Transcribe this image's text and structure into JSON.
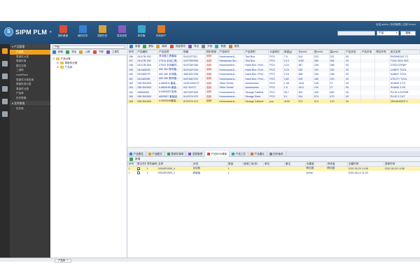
{
  "header": {
    "logo": "SIPM PLM",
    "logo_caret": "▾",
    "user_info": "欢迎,admin | 系统管理 | 注销 Server",
    "search_select": "产品",
    "search_button": "搜索",
    "tools": [
      {
        "label": "我的桌面",
        "color": "#e24a3a",
        "icon": "desktop-icon"
      },
      {
        "label": "我的任务",
        "color": "#3a7fd0",
        "icon": "task-icon"
      },
      {
        "label": "流程任务",
        "color": "#d9a23a",
        "icon": "flow-icon"
      },
      {
        "label": "发送消息",
        "color": "#8a5ac0",
        "icon": "message-icon"
      },
      {
        "label": "收件箱",
        "color": "#3aa6c8",
        "icon": "inbox-icon"
      },
      {
        "label": "在线用户",
        "color": "#e07a2a",
        "icon": "online-user-icon"
      }
    ]
  },
  "rail": [
    {
      "icon": "product-icon",
      "color": "#f0a020"
    },
    {
      "icon": "home-icon",
      "color": "#9aa4ae"
    },
    {
      "icon": "calendar-icon",
      "color": "#9aa4ae"
    },
    {
      "icon": "document-icon",
      "color": "#9aa4ae"
    },
    {
      "icon": "settings-icon",
      "color": "#9aa4ae"
    },
    {
      "icon": "book-icon",
      "color": "#9aa4ae"
    }
  ],
  "nav": {
    "group1": "▾ 产品管理",
    "items": [
      "产品库",
      "零部件分类",
      "零部件库",
      "图文文档",
      "二维码",
      "LeanPlace",
      "零部件分类查询",
      "零部件到分类",
      "零部件分类",
      "产品库",
      "历史数据"
    ],
    "group2": "▾ 文件系统",
    "items2": [
      "历史库"
    ]
  },
  "tree": {
    "search": "产品",
    "toolbar": [
      "刷新",
      "导出",
      "上移",
      "下移",
      "工具栏"
    ],
    "nodes": [
      {
        "label": "产品分类",
        "indent": 0
      },
      {
        "label": "零部件分类",
        "indent": 1
      },
      {
        "label": "产品库",
        "indent": 1
      }
    ]
  },
  "main": {
    "toolbar": [
      "新建",
      "删除",
      "刷新",
      "批量修改",
      "导出",
      "升版",
      "数据",
      "报表"
    ],
    "columns": [
      "序号",
      "产品编码",
      "产品名称",
      "规格",
      "物料类型",
      "产品系列",
      "产品类别",
      "计量单位",
      "单重(g)",
      "长(mm)",
      "宽(mm)",
      "高(mm)",
      "产品状态",
      "产品本地",
      "是否外购",
      "英文名称"
    ],
    "rows": [
      [
        "156",
        "03117B-302",
        "多功能工具套装",
        "5141227321",
        "自制",
        "Homeowner&...",
        "Tool Box",
        "PCS",
        "7.6",
        "514",
        "223",
        "321",
        "00",
        "",
        "",
        "ENGINE342 TC"
      ],
      [
        "157",
        "03117B-300",
        "27515 手动工具...",
        "1157390*384",
        "自制",
        "Handyman Ser...",
        "Tool Box",
        "PCS",
        "14.3",
        "1152",
        "389",
        "384",
        "00",
        "",
        "",
        "TOOL BOX W/E"
      ],
      [
        "158",
        "03117B-504",
        "27523 手持套件...",
        "514*236*266",
        "自制",
        "Homeowner&...",
        "Hand Box / Port...",
        "PCS",
        "4.24",
        "487",
        "236",
        "266",
        "00",
        "",
        "",
        "27523 STRAP"
      ],
      [
        "159",
        "03118522R",
        "#52 381 零件箱...",
        "524*249*240",
        "自制",
        "Homeowner&...",
        "Hand Box / Port...",
        "PCS",
        "3.24",
        "539",
        "249",
        "250",
        "00",
        "",
        "",
        "CARRY TOOL"
      ],
      [
        "160",
        "03118527R",
        "#52 382 手持箱...",
        "468*160*168",
        "自制",
        "Homeowner&...",
        "Hand Box / Port...",
        "PCS",
        "2.16",
        "468",
        "160",
        "168",
        "00",
        "",
        "",
        "HANDY TOOL"
      ],
      [
        "161",
        "03118525R",
        "#52 383 零件箱...",
        "515*185*220",
        "自制",
        "Homeowner&...",
        "Hand Box / Port...",
        "PCS",
        "3.82",
        "515",
        "185",
        "220",
        "00",
        "",
        "",
        "UTILITY TOOL"
      ],
      [
        "162",
        "038 9M1603",
        "#.5805HL 套装...",
        "1244*1004*27",
        "自制",
        "Other Series",
        "Accessories",
        "PCS",
        "1.35",
        "1244",
        "106",
        "27",
        "00",
        "",
        "",
        "SHANK 3 CS"
      ],
      [
        "163",
        "038 9M1600",
        "#.5805HM 套装...",
        "911*104*27",
        "自制",
        "Other Series",
        "Accessories",
        "PCS",
        "1.6",
        "1911",
        "104",
        "27",
        "00",
        "",
        "",
        "SHANK 3 HS"
      ],
      [
        "164",
        "0389M400",
        "#.5453453 柜体...",
        "400*300*640",
        "自制",
        "Homeowner&...",
        "Storage Cabinet",
        "PCS",
        "25.7",
        "400",
        "300",
        "640",
        "00",
        "",
        "",
        "PLUS 3 ESTNR"
      ],
      [
        "165",
        "038 9M1500",
        "#553557 套装组...",
        "514*574*470",
        "自制",
        "Homeowner&...",
        "Storage Rack",
        "PCS",
        "5.1",
        "514",
        "574",
        "470",
        "00",
        "",
        "",
        "PLUS 3 CUT"
      ],
      [
        "166",
        "038 9M1505",
        "#.5453445套装...",
        "574*574*470",
        "自制",
        "Homeowner&...",
        "Storage Cabinet",
        "pcs",
        "3100",
        "574",
        "574",
        "470",
        "00",
        "",
        "",
        "ORGANISER 3"
      ]
    ],
    "selected_row": 10
  },
  "tabs": [
    {
      "label": "产品属性",
      "color": "#3a7fd0",
      "icon": "attribute-icon"
    },
    {
      "label": "产品图文",
      "color": "#d9a23a",
      "icon": "image-icon"
    },
    {
      "label": "零部件清单",
      "color": "#3aa64a",
      "icon": "bom-icon"
    },
    {
      "label": "变更管理",
      "color": "#8a5ac0",
      "icon": "change-icon"
    },
    {
      "label": "产品BOM清单",
      "color": "#e24a3a",
      "icon": "bom-list-icon",
      "active": true
    },
    {
      "label": "产品工艺",
      "color": "#3aa6c8",
      "icon": "process-icon"
    },
    {
      "label": "产品图片",
      "color": "#e07a2a",
      "icon": "picture-icon"
    },
    {
      "label": "历史版本",
      "color": "#7a8a9a",
      "icon": "history-icon"
    }
  ],
  "detail": {
    "toolbar": [
      "新增"
    ],
    "columns": [
      "序号",
      "是否关联",
      "零件编码",
      "名称",
      "状态",
      "数量",
      "使用工序(件)",
      "单位",
      "备注",
      "创建者",
      "修改者",
      "创建时间",
      "更新时间"
    ],
    "rows": [
      {
        "no": "1",
        "checked": true,
        "flag": "1",
        "code": "03918R1505_4",
        "name": "台钻板",
        "status": "",
        "qty": "1",
        "proc": "",
        "unit": "",
        "note": "",
        "creator": "韩志国",
        "modifier": "韩志国",
        "created": "2020-05-20 14:58",
        "updated": "2020-05-20 14:58"
      },
      {
        "no": "2",
        "checked": false,
        "flag": "2",
        "code": "03918R1505_3",
        "name": "底板板",
        "status": "",
        "qty": "1",
        "proc": "",
        "unit": "",
        "note": "",
        "creator": "admin",
        "modifier": "",
        "created": "2020-06-12 11:26",
        "updated": ""
      }
    ]
  },
  "status": {
    "tab": "产品库",
    "close": "×"
  }
}
